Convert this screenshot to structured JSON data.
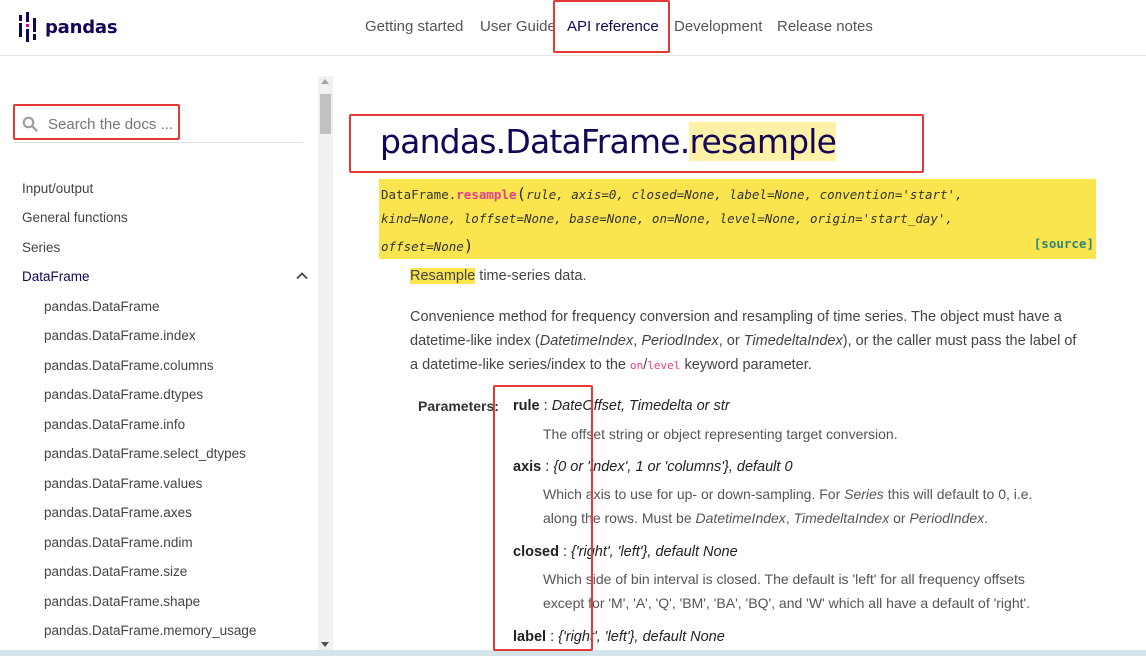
{
  "header": {
    "logo_text": "pandas",
    "nav": [
      "Getting started",
      "User Guide",
      "API reference",
      "Development",
      "Release notes"
    ],
    "active_nav": "API reference"
  },
  "sidebar": {
    "search_placeholder": "Search the docs ...",
    "sections": [
      "Input/output",
      "General functions",
      "Series",
      "DataFrame"
    ],
    "active_section": "DataFrame",
    "items": [
      "pandas.DataFrame",
      "pandas.DataFrame.index",
      "pandas.DataFrame.columns",
      "pandas.DataFrame.dtypes",
      "pandas.DataFrame.info",
      "pandas.DataFrame.select_dtypes",
      "pandas.DataFrame.values",
      "pandas.DataFrame.axes",
      "pandas.DataFrame.ndim",
      "pandas.DataFrame.size",
      "pandas.DataFrame.shape",
      "pandas.DataFrame.memory_usage"
    ]
  },
  "main": {
    "title_prefix": "pandas.DataFrame.",
    "title_highlight": "resample",
    "signature": {
      "obj": "DataFrame.",
      "fn": "resample",
      "open": "(",
      "line1": "rule, axis=0, closed=None, label=None, convention='start',",
      "line2": "kind=None, loffset=None, base=None, on=None, level=None, origin='start_day',",
      "line3": "offset=None",
      "close": ")",
      "source": "[source]"
    },
    "summary_highlight": "Resample",
    "summary_rest": " time-series data.",
    "desc": {
      "l1": "Convenience method for frequency conversion and resampling of time series. The object must have a",
      "l2a": "datetime-like index (",
      "l2b": "DatetimeIndex",
      "l2c": ", ",
      "l2d": "PeriodIndex",
      "l2e": ", or ",
      "l2f": "TimedeltaIndex",
      "l2g": "), or the caller must pass the label of",
      "l3a": "a datetime-like series/index to the ",
      "l3b": "on",
      "l3c": "/",
      "l3d": "level",
      "l3e": " keyword parameter."
    },
    "parameters_label": "Parameters:",
    "params": [
      {
        "name": "rule",
        "type": "DateOffset, Timedelta or str",
        "desc": "The offset string or object representing target conversion."
      },
      {
        "name": "axis",
        "type": "{0 or 'index', 1 or 'columns'}, default 0",
        "desc1a": "Which axis to use for up- or down-sampling. For ",
        "desc1b": "Series",
        "desc1c": " this will default to 0, i.e.",
        "desc2a": "along the rows. Must be ",
        "desc2b": "DatetimeIndex",
        "desc2c": ", ",
        "desc2d": "TimedeltaIndex",
        "desc2e": " or ",
        "desc2f": "PeriodIndex",
        "desc2g": "."
      },
      {
        "name": "closed",
        "type": "{'right', 'left'}, default None",
        "desc1": "Which side of bin interval is closed. The default is 'left' for all frequency offsets",
        "desc2": "except for 'M', 'A', 'Q', 'BM', 'BA', 'BQ', and 'W' which all have a default of 'right'."
      },
      {
        "name": "label",
        "type": "{'right', 'left'}, default None"
      }
    ],
    "param_sep": " : "
  },
  "colors": {
    "brand": "#130654",
    "signature_bg": "#fbe54e",
    "highlight": "#fff1a8",
    "annotation": "#e53935"
  }
}
